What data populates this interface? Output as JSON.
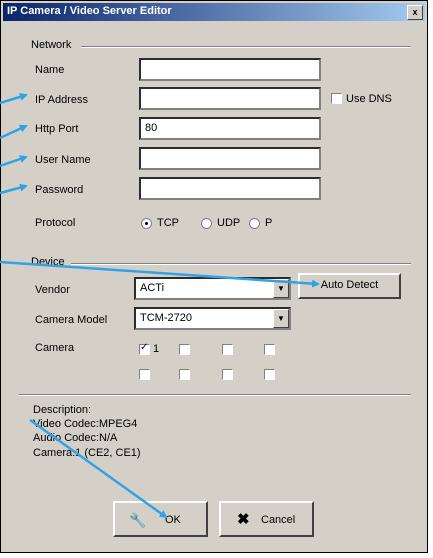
{
  "window": {
    "title": "IP Camera / Video Server Editor",
    "close_label": "x"
  },
  "network": {
    "section_label": "Network",
    "name_label": "Name",
    "name_value": "",
    "ip_label": "IP Address",
    "ip_value": "",
    "use_dns_label": "Use DNS",
    "http_port_label": "Http Port",
    "http_port_value": "80",
    "user_name_label": "User Name",
    "user_name_value": "",
    "password_label": "Password",
    "password_value": "",
    "protocol_label": "Protocol",
    "protocol_options": [
      "TCP",
      "UDP",
      "P"
    ]
  },
  "device": {
    "section_label": "Device",
    "vendor_label": "Vendor",
    "vendor_value": "ACTi",
    "auto_detect_label": "Auto Detect",
    "camera_model_label": "Camera Model",
    "camera_model_value": "TCM-2720",
    "camera_label": "Camera",
    "camera_index_label": "1"
  },
  "description": {
    "title": "Description:",
    "lines": [
      "Video Codec:MPEG4",
      "Audio Codec:N/A",
      "Camera:1 (CE2, CE1)"
    ]
  },
  "buttons": {
    "ok_label": "OK",
    "cancel_label": "Cancel"
  },
  "colors": {
    "arrow": "#2fa3e6",
    "title_start": "#0a246a",
    "title_end": "#a6caf0"
  }
}
